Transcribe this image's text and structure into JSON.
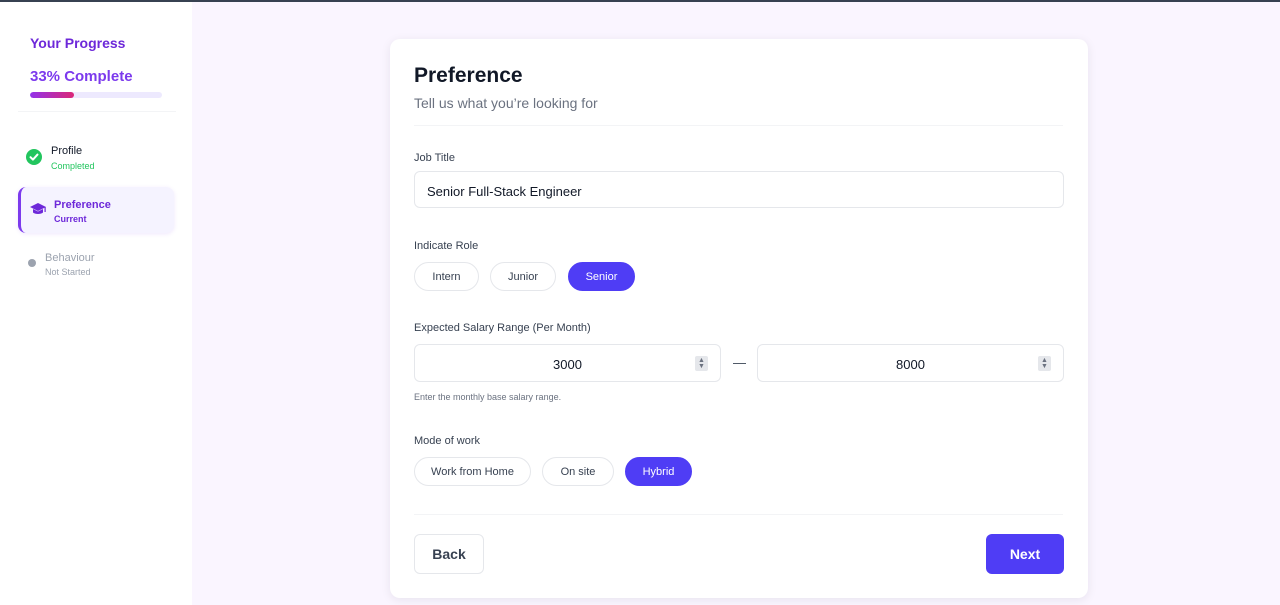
{
  "sidebar": {
    "title": "Your Progress",
    "percent_label": "33% Complete",
    "progress": 0.33,
    "steps": [
      {
        "name": "Profile",
        "status": "Completed",
        "state": "done",
        "icon": "check-circle-icon"
      },
      {
        "name": "Preference",
        "status": "Current",
        "state": "current",
        "icon": "graduation-cap-icon"
      },
      {
        "name": "Behaviour",
        "status": "Not Started",
        "state": "pending",
        "icon": "dot-icon"
      }
    ]
  },
  "card": {
    "title": "Preference",
    "subtitle": "Tell us what you’re looking for"
  },
  "job_title": {
    "label": "Job Title",
    "value": "Senior Full-Stack Engineer"
  },
  "role": {
    "label": "Indicate Role",
    "options": [
      "Intern",
      "Junior",
      "Senior"
    ],
    "selected": "Senior"
  },
  "salary": {
    "label": "Expected Salary Range (Per Month)",
    "min": "3000",
    "max": "8000",
    "separator": "—",
    "hint": "Enter the monthly base salary range."
  },
  "work_mode": {
    "label": "Mode of work",
    "options": [
      "Work from Home",
      "On site",
      "Hybrid"
    ],
    "selected": "Hybrid"
  },
  "footer": {
    "back_label": "Back",
    "next_label": "Next"
  },
  "colors": {
    "accent": "#4f3df5",
    "purple": "#7c3aed",
    "success": "#22c55e",
    "page_bg": "#faf5ff"
  }
}
